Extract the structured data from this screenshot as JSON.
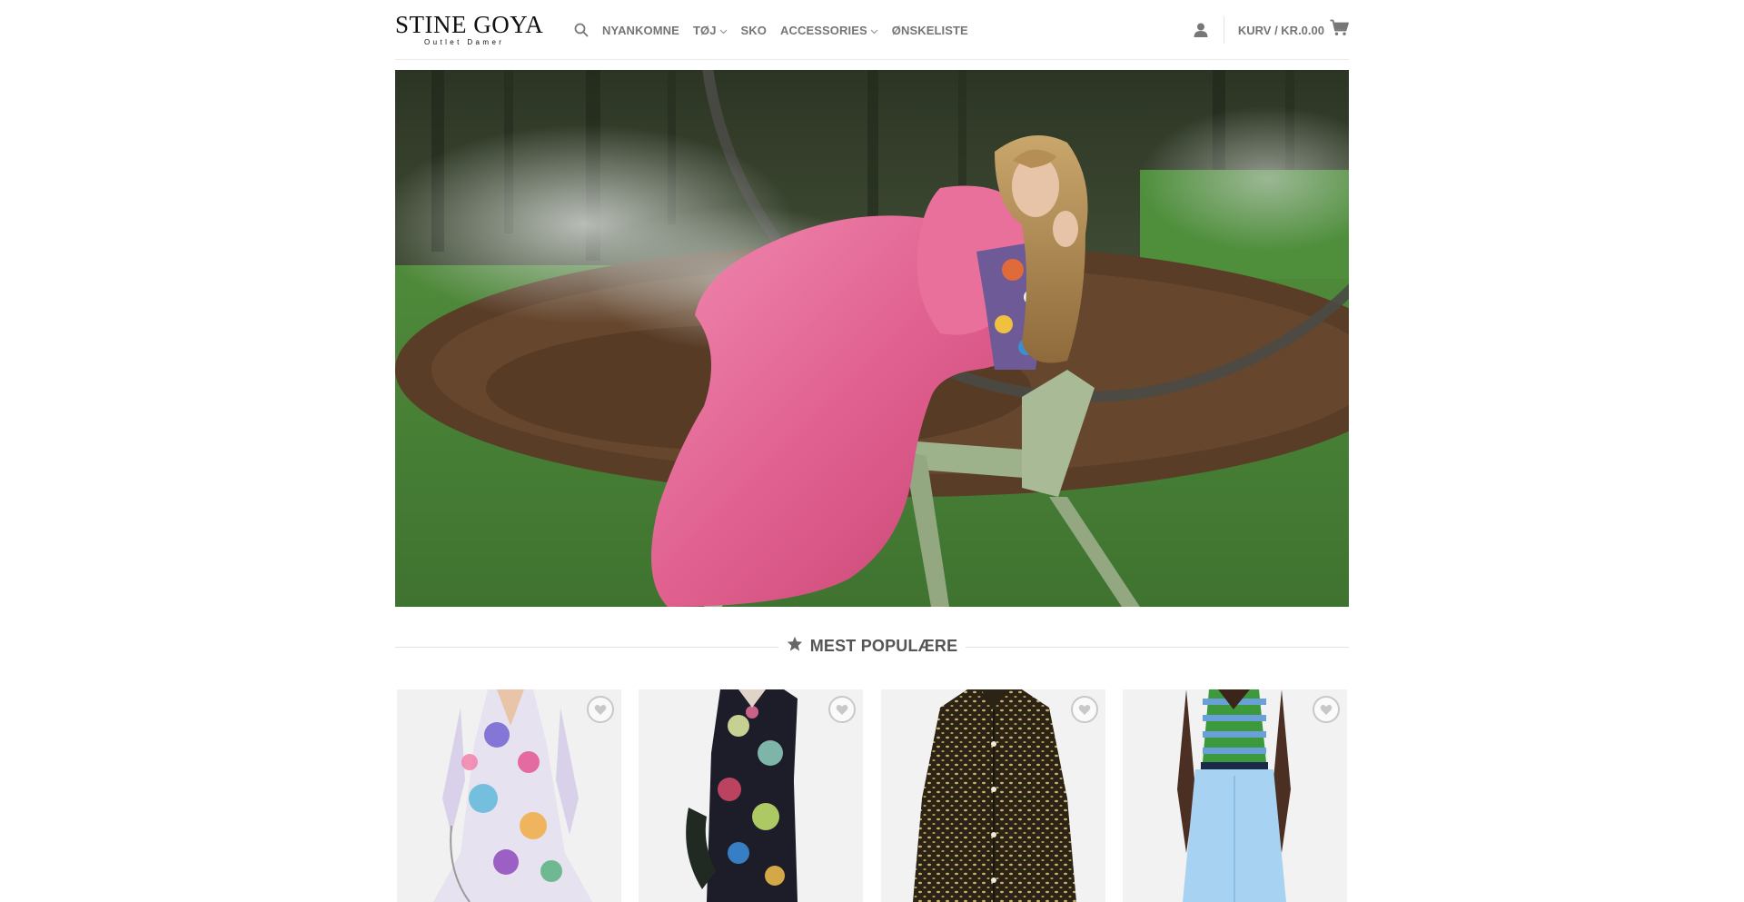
{
  "brand": {
    "name": "STINE GOYA",
    "tagline": "Outlet Damer"
  },
  "nav": {
    "items": [
      {
        "label": "NYANKOMNE",
        "has_dropdown": false
      },
      {
        "label": "TØJ",
        "has_dropdown": true
      },
      {
        "label": "SKO",
        "has_dropdown": false
      },
      {
        "label": "ACCESSORIES",
        "has_dropdown": true
      },
      {
        "label": "ØNSKELISTE",
        "has_dropdown": false
      }
    ]
  },
  "header": {
    "cart_label": "KURV / KR.0.00"
  },
  "icons": {
    "search": "search-icon",
    "account": "user-icon",
    "cart": "shopping-cart-icon",
    "section": "star-icon",
    "wishlist": "heart-icon",
    "dropdown": "chevron-down-icon"
  },
  "sections": {
    "popular_title": "MEST POPULÆRE"
  },
  "colors": {
    "nav_text": "#757575",
    "dress_pink": "#e0608f",
    "chair_green": "#9db18a",
    "grass": "#4f8a3a"
  },
  "products": [
    {
      "name": "floral-print-dress"
    },
    {
      "name": "dark-floral-maxi-dress"
    },
    {
      "name": "black-patterned-shirt"
    },
    {
      "name": "striped-knit-vest-blue-trousers"
    }
  ]
}
